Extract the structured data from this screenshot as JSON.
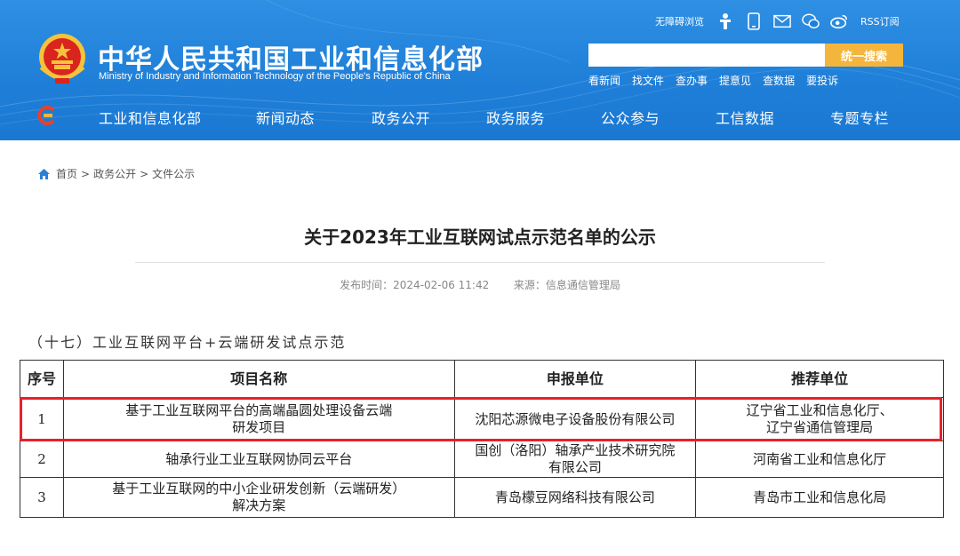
{
  "header": {
    "title": "中华人民共和国工业和信息化部",
    "subtitle": "Ministry of Industry and Information Technology of the People's Republic of China",
    "top_links": {
      "accessibility": "无障碍浏览",
      "rss": "RSS订阅"
    },
    "search": {
      "placeholder": "",
      "button_label": "统一搜索"
    },
    "quick_links": [
      "看新闻",
      "找文件",
      "查办事",
      "提意见",
      "查数据",
      "要投诉"
    ],
    "nav": [
      "工业和信息化部",
      "新闻动态",
      "政务公开",
      "政务服务",
      "公众参与",
      "工信数据",
      "专题专栏"
    ]
  },
  "breadcrumb": [
    "首页",
    "政务公开",
    "文件公示"
  ],
  "breadcrumb_sep": ">",
  "article": {
    "title": "关于2023年工业互联网试点示范名单的公示",
    "publish_label": "发布时间：2024-02-06 11:42",
    "source_label": "来源：信息通信管理局",
    "section_heading": "（十七）工业互联网平台+云端研发试点示范"
  },
  "table": {
    "headers": [
      "序号",
      "项目名称",
      "申报单位",
      "推荐单位"
    ],
    "rows": [
      {
        "no": "1",
        "name_line1": "基于工业互联网平台的高端晶圆处理设备云端",
        "name_line2": "研发项目",
        "unit_line1": "沈阳芯源微电子设备股份有限公司",
        "unit_line2": "",
        "rec_line1": "辽宁省工业和信息化厅、",
        "rec_line2": "辽宁省通信管理局"
      },
      {
        "no": "2",
        "name_line1": "轴承行业工业互联网协同云平台",
        "name_line2": "",
        "unit_line1": "国创（洛阳）轴承产业技术研究院",
        "unit_line2": "有限公司",
        "rec_line1": "河南省工业和信息化厅",
        "rec_line2": ""
      },
      {
        "no": "3",
        "name_line1": "基于工业互联网的中小企业研发创新（云端研发）",
        "name_line2": "解决方案",
        "unit_line1": "青岛檬豆网络科技有限公司",
        "unit_line2": "",
        "rec_line1": "青岛市工业和信息化局",
        "rec_line2": ""
      }
    ]
  },
  "colors": {
    "header_blue": "#1f7fd8",
    "search_button": "#f4b53c",
    "highlight_red": "#e8212a"
  },
  "icons": [
    "emblem-icon",
    "accessibility-icon",
    "mobile-icon",
    "mail-icon",
    "wechat-icon",
    "weibo-icon",
    "nav-logo-icon",
    "home-icon"
  ]
}
